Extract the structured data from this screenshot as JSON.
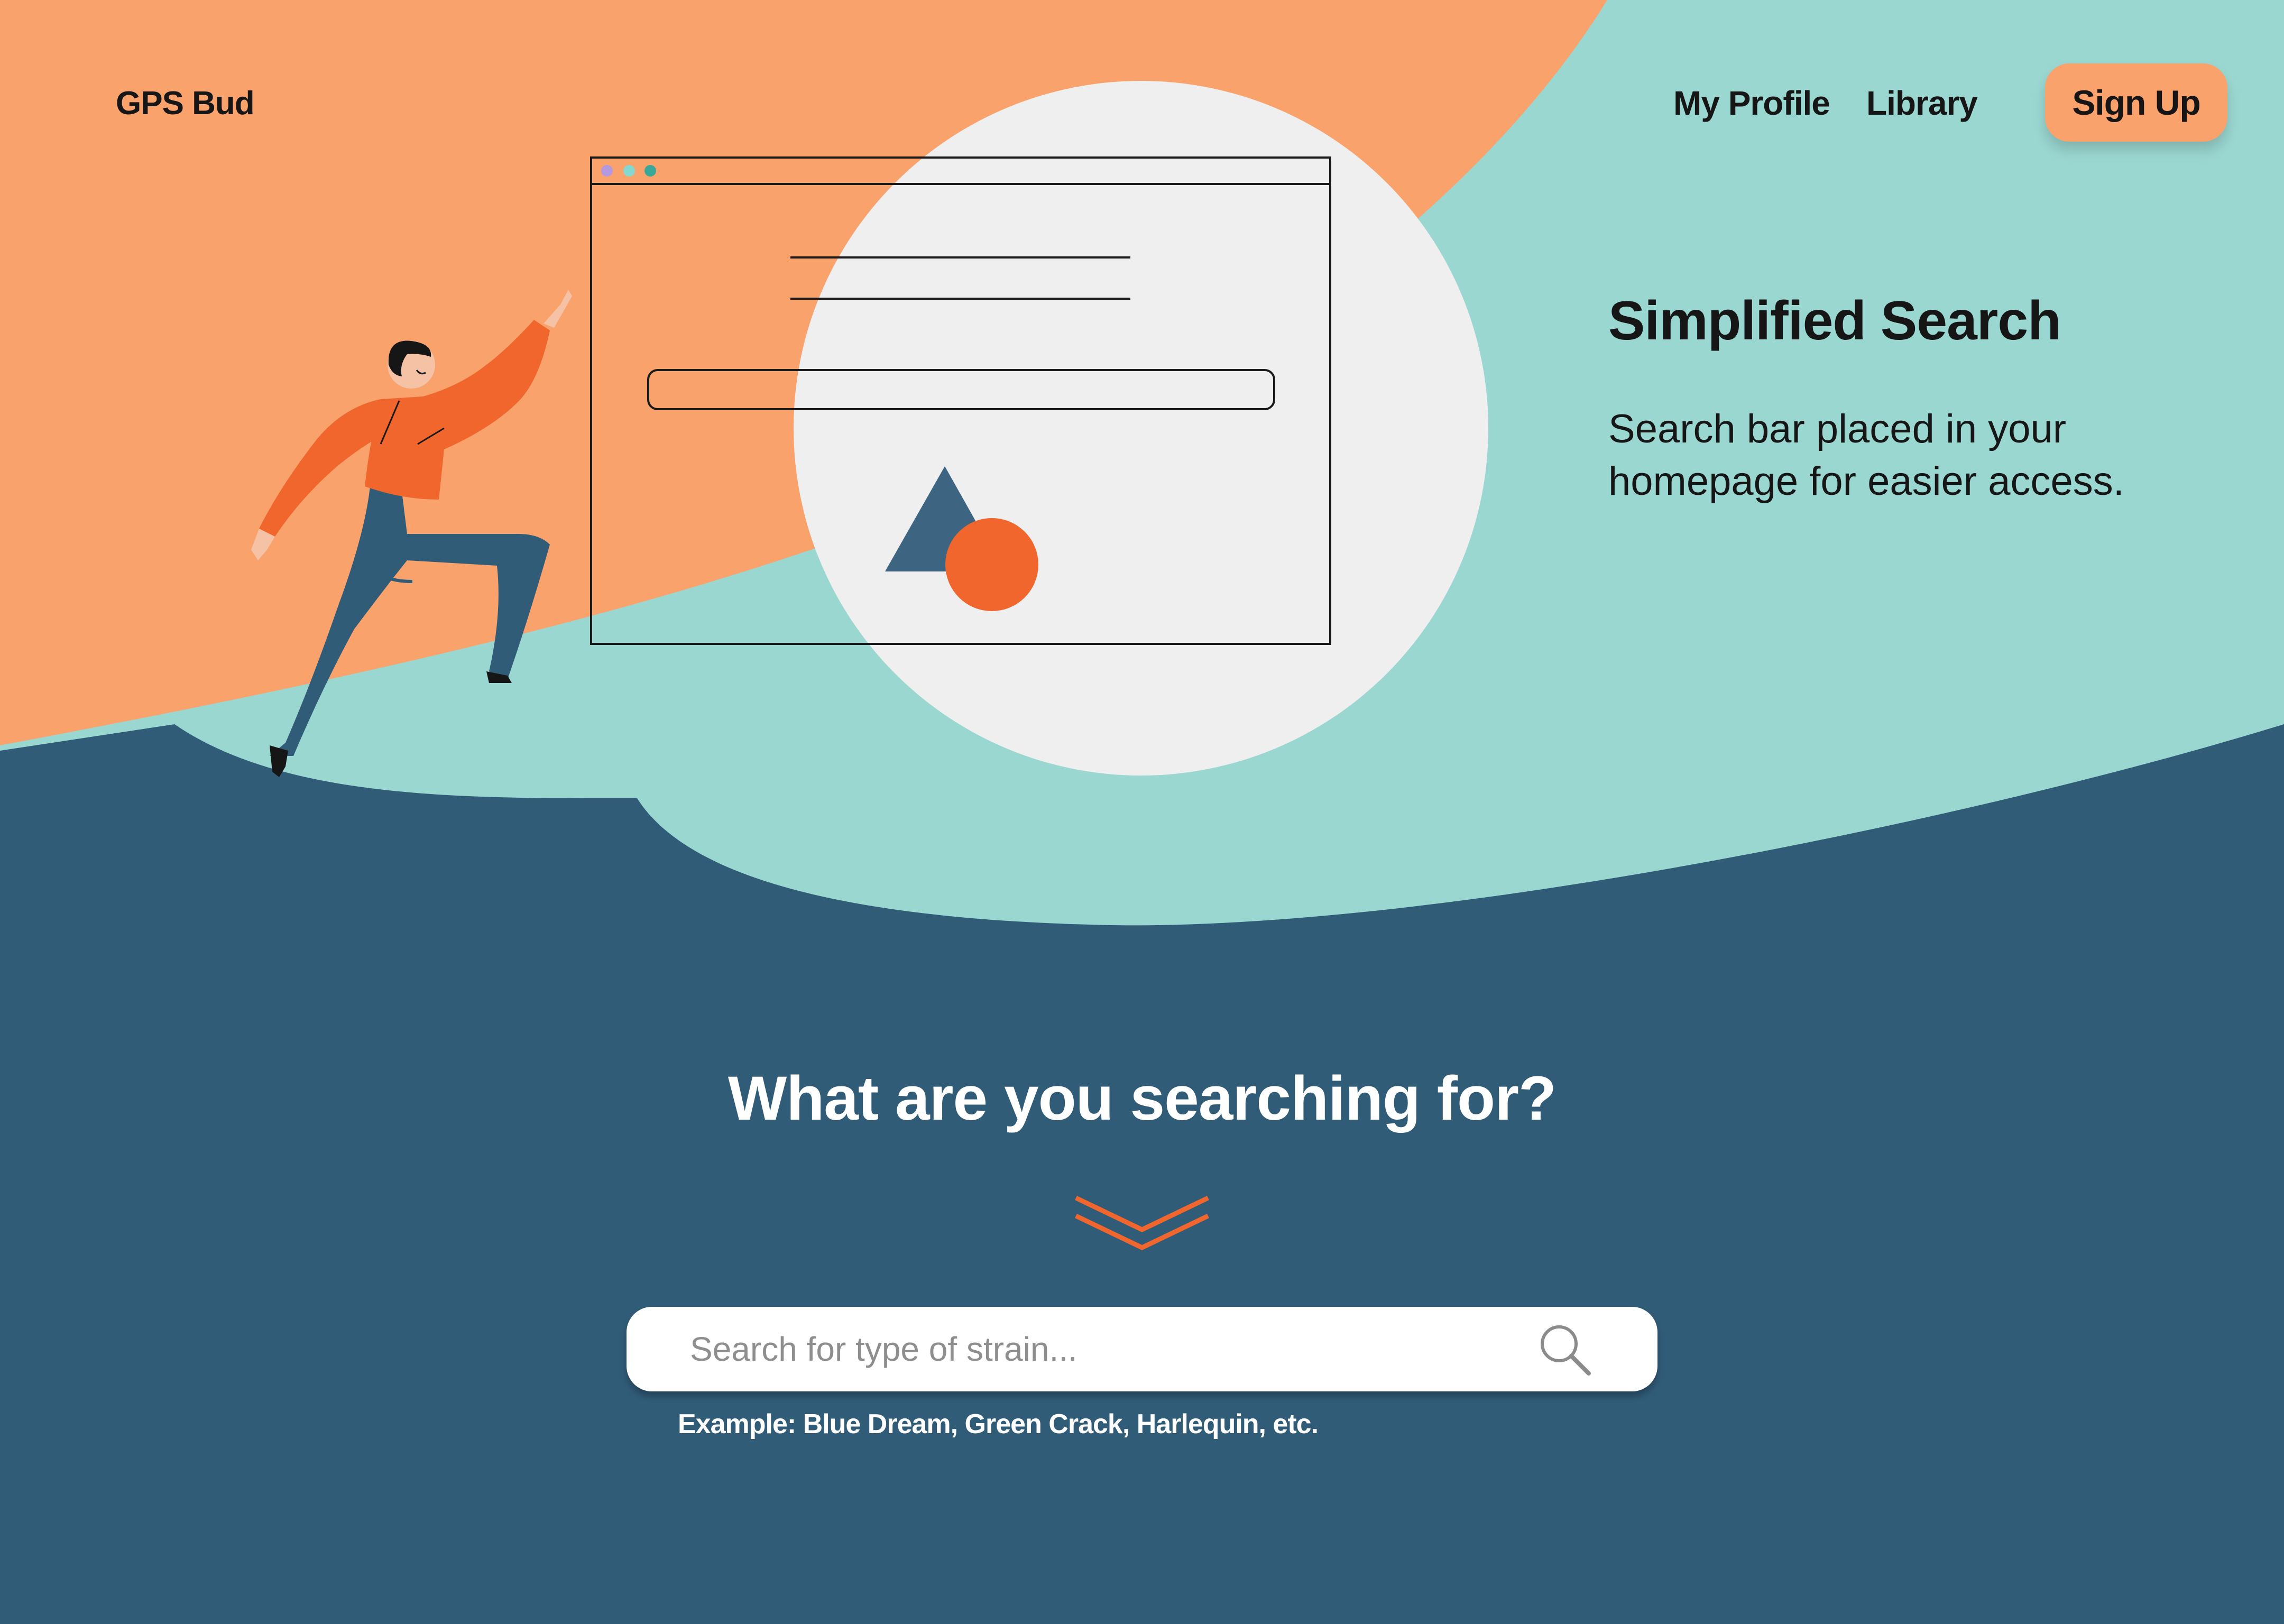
{
  "nav": {
    "logo": "GPS Bud",
    "links": [
      "My Profile",
      "Library"
    ],
    "signup_label": "Sign Up"
  },
  "feature": {
    "title": "Simplified Search",
    "description": "Search bar placed in your homepage for easier access."
  },
  "search": {
    "heading": "What are you searching for?",
    "placeholder": "Search for type of strain...",
    "example": "Example: Blue Dream, Green Crack, Harlequin, etc."
  },
  "colors": {
    "orange_light": "#f9a26c",
    "mint": "#9bd7d1",
    "navy": "#315c78",
    "accent_orange": "#f1662d",
    "light_gray": "#efefef"
  },
  "icons": [
    "chevron-down-icon",
    "search-icon"
  ]
}
